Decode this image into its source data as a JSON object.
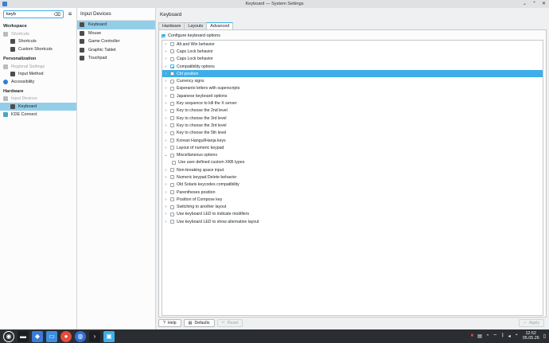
{
  "window": {
    "title": "Keyboard — System Settings"
  },
  "sidebar": {
    "search_value": "keyb",
    "sections": [
      {
        "label": "Workspace",
        "items": [
          {
            "label": "Shortcuts",
            "level": 0,
            "dim": true,
            "icon": "keyboard-icon"
          },
          {
            "label": "Shortcuts",
            "level": 1,
            "dim": false,
            "icon": "shortcuts-icon"
          },
          {
            "label": "Custom Shortcuts",
            "level": 1,
            "dim": false,
            "icon": "custom-shortcuts-icon"
          }
        ]
      },
      {
        "label": "Personalization",
        "items": [
          {
            "label": "Regional Settings",
            "level": 0,
            "dim": true,
            "icon": "globe-icon"
          },
          {
            "label": "Input Method",
            "level": 1,
            "dim": false,
            "icon": "input-method-icon"
          },
          {
            "label": "Accessibility",
            "level": 0,
            "dim": false,
            "icon": "accessibility-icon"
          }
        ]
      },
      {
        "label": "Hardware",
        "items": [
          {
            "label": "Input Devices",
            "level": 0,
            "dim": true,
            "icon": "input-devices-icon"
          },
          {
            "label": "Keyboard",
            "level": 1,
            "dim": false,
            "active": true,
            "icon": "keyboard-icon"
          },
          {
            "label": "KDE Connect",
            "level": 0,
            "dim": false,
            "icon": "kde-connect-icon"
          }
        ]
      }
    ]
  },
  "middle": {
    "header": "Input Devices",
    "items": [
      "Keyboard",
      "Mouse",
      "Game Controller",
      "Graphic Tablet",
      "Touchpad"
    ]
  },
  "main": {
    "header": "Keyboard",
    "tabs": [
      "Hardware",
      "Layouts",
      "Advanced"
    ],
    "active_tab": "Advanced",
    "configure_label": "Configure keyboard options",
    "options": [
      {
        "label": "Alt and Win behavior",
        "expanded": false
      },
      {
        "label": "Caps Lock behavior",
        "expanded": false
      },
      {
        "label": "Caps Lock behavior",
        "expanded": false
      },
      {
        "label": "Compatibility options",
        "expanded": false,
        "partial": true
      },
      {
        "label": "Ctrl position",
        "expanded": false,
        "selected": true
      },
      {
        "label": "Currency signs",
        "expanded": false
      },
      {
        "label": "Esperanto letters with superscripts",
        "expanded": false
      },
      {
        "label": "Japanese keyboard options",
        "expanded": false
      },
      {
        "label": "Key sequence to kill the X server",
        "expanded": false
      },
      {
        "label": "Key to choose the 2nd level",
        "expanded": false
      },
      {
        "label": "Key to choose the 3rd level",
        "expanded": false
      },
      {
        "label": "Key to choose the 3rd level",
        "expanded": false
      },
      {
        "label": "Key to choose the 5th level",
        "expanded": false
      },
      {
        "label": "Korean Hangul/Hanja keys",
        "expanded": false
      },
      {
        "label": "Layout of numeric keypad",
        "expanded": false
      },
      {
        "label": "Miscellaneous options",
        "expanded": true
      },
      {
        "label": "Use user-defined custom XKB types",
        "child": true
      },
      {
        "label": "Non-breaking space input",
        "expanded": false
      },
      {
        "label": "Numeric keypad Delete behavior",
        "expanded": false
      },
      {
        "label": "Old Solaris keycodes compatibility",
        "expanded": false
      },
      {
        "label": "Parentheses position",
        "expanded": false
      },
      {
        "label": "Position of Compose key",
        "expanded": false
      },
      {
        "label": "Switching to another layout",
        "expanded": false
      },
      {
        "label": "Use keyboard LED to indicate modifiers",
        "expanded": false
      },
      {
        "label": "Use keyboard LED to show alternative layout",
        "expanded": false
      }
    ],
    "buttons": {
      "help": "Help",
      "defaults": "Defaults",
      "reset": "Reset",
      "apply": "Apply"
    }
  },
  "taskbar": {
    "time": "12:52",
    "date": "05.05.26"
  }
}
